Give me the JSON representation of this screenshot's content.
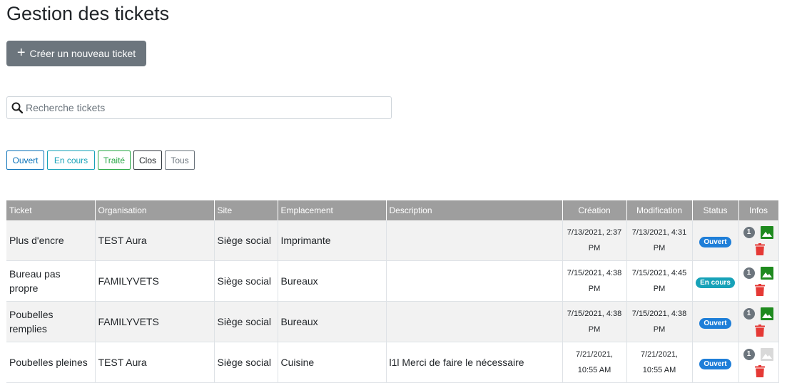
{
  "page": {
    "title": "Gestion des tickets"
  },
  "toolbar": {
    "new_ticket_label": "Créer un nouveau ticket"
  },
  "search": {
    "placeholder": "Recherche tickets",
    "value": ""
  },
  "filters": [
    "Ouvert",
    "En cours",
    "Traité",
    "Clos",
    "Tous"
  ],
  "table": {
    "headers": [
      "Ticket",
      "Organisation",
      "Site",
      "Emplacement",
      "Description",
      "Création",
      "Modification",
      "Status",
      "Infos"
    ],
    "rows": [
      {
        "ticket": "Plus d'encre",
        "organisation": "TEST Aura",
        "site": "Siège social",
        "emplacement": "Imprimante",
        "description": "",
        "creation_1": "7/13/2021, 2:37",
        "creation_2": "PM",
        "modification_1": "7/13/2021, 4:31",
        "modification_2": "PM",
        "status": "Ouvert",
        "count": "1",
        "has_image": true
      },
      {
        "ticket": "Bureau pas propre",
        "organisation": "FAMILYVETS",
        "site": "Siège social",
        "emplacement": "Bureaux",
        "description": "",
        "creation_1": "7/15/2021, 4:38",
        "creation_2": "PM",
        "modification_1": "7/15/2021, 4:45",
        "modification_2": "PM",
        "status": "En cours",
        "count": "1",
        "has_image": true
      },
      {
        "ticket": "Poubelles remplies",
        "organisation": "FAMILYVETS",
        "site": "Siège social",
        "emplacement": "Bureaux",
        "description": "",
        "creation_1": "7/15/2021, 4:38",
        "creation_2": "PM",
        "modification_1": "7/15/2021, 4:38",
        "modification_2": "PM",
        "status": "Ouvert",
        "count": "1",
        "has_image": true
      },
      {
        "ticket": "Poubelles pleines",
        "organisation": "TEST Aura",
        "site": "Siège social",
        "emplacement": "Cuisine",
        "description": "l1l Merci de faire le nécessaire",
        "creation_1": "7/21/2021,",
        "creation_2": "10:55 AM",
        "modification_1": "7/21/2021,",
        "modification_2": "10:55 AM",
        "status": "Ouvert",
        "count": "1",
        "has_image": false
      }
    ]
  },
  "colors": {
    "image_active": "#1e8a1e",
    "image_inactive": "#d9d9d9",
    "trash": "#e53935",
    "badge_ouvert": "#1e7ed8",
    "badge_en_cours": "#17a2b8"
  },
  "icons": {
    "search": "magnifier-icon",
    "plus": "plus-icon",
    "image": "image-icon",
    "delete": "trash-icon"
  }
}
